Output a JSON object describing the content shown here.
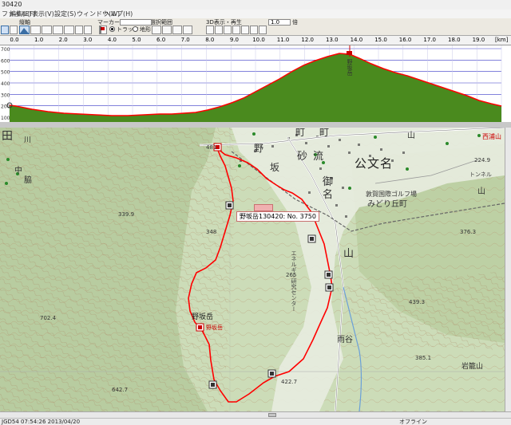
{
  "window": {
    "title": "30420"
  },
  "menu": [
    "ファイル(F)",
    "編集(E)",
    "表示(V)",
    "設定(S)",
    "ウィンドウ(W)",
    "ヘルプ(H)"
  ],
  "toolbar": {
    "section_labels": [
      "縦軸",
      "マーカー",
      "選択範囲",
      "3D表示・再生"
    ],
    "radio_track": "トラック",
    "radio_terrain": "地形",
    "speed_value": "1.0",
    "speed_unit": "倍"
  },
  "ruler": {
    "ticks": [
      "0.0",
      "1.0",
      "2.0",
      "3.0",
      "4.0",
      "5.0",
      "6.0",
      "7.0",
      "8.0",
      "9.0",
      "10.0",
      "11.0",
      "12.0",
      "13.0",
      "14.0",
      "15.0",
      "16.0",
      "17.0",
      "18.0",
      "19.0"
    ],
    "unit": "[km]"
  },
  "profile": {
    "y_ticks": [
      "700",
      "600",
      "500",
      "400",
      "300",
      "200",
      "100"
    ],
    "peak_label": "野坂岳",
    "colors": {
      "fill": "#4a8a1e",
      "line": "#ff0000",
      "grid": "#3838c8"
    }
  },
  "tooltip": {
    "text": "野坂岳130420: No. 3750"
  },
  "map_labels": {
    "town1": "町",
    "town2": "町",
    "nosaka": "野",
    "nosaka2": "坂",
    "kanji_sa": "砂",
    "kanji_ryu": "流",
    "kanji_mi": "御",
    "kanji_na": "名",
    "kobunmei": "公文名",
    "golf": "敦賀国際ゴルフ場",
    "midorigaoka": "みどり丘町",
    "yama": "山",
    "yama2": "山",
    "yama3": "山",
    "ta": "田",
    "kawa": "川",
    "chu": "中",
    "shu": "脇",
    "ent1": "エネルギー研究センター",
    "amedani": "雨谷",
    "peak_name": "野坂岳",
    "peak_marker": "野坂岳",
    "iwakura": "岩籠山",
    "nishiura": "西浦山",
    "tunnel": "トンネル",
    "h1": "481",
    "h2": "339.9",
    "h3": "348",
    "h4": "265",
    "h5": "224.9",
    "h6": "376.3",
    "h7": "439.3",
    "h8": "702.4",
    "h9": "422.7",
    "h10": "642.7",
    "h11": "385.1"
  },
  "status": {
    "left": "JGD54  07:54:26  2013/04/20",
    "right": "オフライン"
  }
}
